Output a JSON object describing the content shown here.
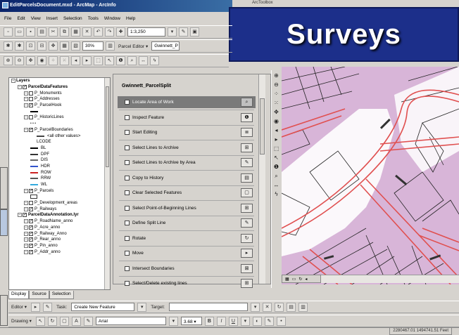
{
  "window": {
    "title": "EditParcelsDocument.mxd - ArcMap - ArcInfo",
    "menu": [
      "File",
      "Edit",
      "View",
      "Insert",
      "Selection",
      "Tools",
      "Window",
      "Help"
    ]
  },
  "toolbars": {
    "scale": "1:3,250",
    "zoom": "30%",
    "parcel_editor": "Parcel Editor ▾",
    "parcel_layer": "Gwinnett_P"
  },
  "toolbox_label": "ArcToolbox",
  "overlay_title": "Surveys",
  "toc": {
    "header": "Layers",
    "items": [
      {
        "label": "Layers",
        "indent": 0,
        "kind": "group"
      },
      {
        "label": "ParcelDataFeatures",
        "indent": 1,
        "kind": "group",
        "checked": true
      },
      {
        "label": "P_Monuments",
        "indent": 2,
        "kind": "layer",
        "checked": false
      },
      {
        "label": "P_Addresses",
        "indent": 2,
        "kind": "layer",
        "checked": false
      },
      {
        "label": "P_ParcelHook",
        "indent": 2,
        "kind": "layer",
        "checked": true
      },
      {
        "label": "",
        "indent": 3,
        "kind": "line",
        "color": "#000000"
      },
      {
        "label": "P_HistoricLines",
        "indent": 2,
        "kind": "layer",
        "checked": false
      },
      {
        "label": "",
        "indent": 3,
        "kind": "dots"
      },
      {
        "label": "P_ParcelBoundaries",
        "indent": 2,
        "kind": "layer",
        "checked": true
      },
      {
        "label": "<all other values>",
        "indent": 4,
        "kind": "line",
        "color": "#444444"
      },
      {
        "label": "LCODE",
        "indent": 4,
        "kind": "text"
      },
      {
        "label": "BL",
        "indent": 3,
        "kind": "line",
        "color": "#000000"
      },
      {
        "label": "DPF",
        "indent": 3,
        "kind": "line",
        "color": "#333333"
      },
      {
        "label": "DIS",
        "indent": 3,
        "kind": "line",
        "color": "#666666"
      },
      {
        "label": "HDR",
        "indent": 3,
        "kind": "line",
        "color": "#3355cc"
      },
      {
        "label": "ROW",
        "indent": 3,
        "kind": "line",
        "color": "#cc2222"
      },
      {
        "label": "RRW",
        "indent": 3,
        "kind": "line",
        "color": "#555555"
      },
      {
        "label": "WL",
        "indent": 3,
        "kind": "line",
        "color": "#33aadd"
      },
      {
        "label": "P_Parcels",
        "indent": 2,
        "kind": "layer",
        "checked": true
      },
      {
        "label": "",
        "indent": 3,
        "kind": "box"
      },
      {
        "label": "P_Development_areas",
        "indent": 2,
        "kind": "layer",
        "checked": false
      },
      {
        "label": "P_Railways",
        "indent": 2,
        "kind": "layer",
        "checked": true
      },
      {
        "label": "ParcelDataAnnotation.lyr",
        "indent": 1,
        "kind": "group",
        "checked": true
      },
      {
        "label": "P_RoadName_anno",
        "indent": 2,
        "kind": "layer",
        "checked": true
      },
      {
        "label": "P_Acre_anno",
        "indent": 2,
        "kind": "layer",
        "checked": true
      },
      {
        "label": "P_Railway_Anno",
        "indent": 2,
        "kind": "layer",
        "checked": true
      },
      {
        "label": "P_Rear_anno",
        "indent": 2,
        "kind": "layer",
        "checked": true
      },
      {
        "label": "P_Pin_anno",
        "indent": 2,
        "kind": "layer",
        "checked": true
      },
      {
        "label": "P_Addr_anno",
        "indent": 2,
        "kind": "layer",
        "checked": true
      }
    ],
    "tabs": [
      "Display",
      "Source",
      "Selection"
    ]
  },
  "parcel_panel": {
    "title": "Gwinnett_ParcelSplit",
    "rows": [
      {
        "label": "Locate Area of Work",
        "icon": "⌕",
        "selected": true
      },
      {
        "label": "Inspect Feature",
        "icon": "❶",
        "selected": false
      },
      {
        "label": "Start Editing",
        "icon": "≣",
        "selected": false
      },
      {
        "label": "Select Lines to Archive",
        "icon": "⊞",
        "selected": false
      },
      {
        "label": "Select Lines to Archive by Area",
        "icon": "✎",
        "selected": false
      },
      {
        "label": "Copy to History",
        "icon": "▤",
        "selected": false
      },
      {
        "label": "Clear Selected Features",
        "icon": "▢",
        "selected": false
      },
      {
        "label": "Select Point-of-Beginning Lines",
        "icon": "⊞",
        "selected": false
      },
      {
        "label": "Define Split Line",
        "icon": "✎",
        "selected": false
      },
      {
        "label": "Rotate",
        "icon": "↻",
        "selected": false
      },
      {
        "label": "Move",
        "icon": "▸",
        "selected": false
      },
      {
        "label": "Intersect Boundaries",
        "icon": "⊠",
        "selected": false
      },
      {
        "label": "Select/Delete existing lines",
        "icon": "⊞",
        "selected": false
      }
    ]
  },
  "editor_toolbar": {
    "editor": "Editor ▾",
    "task_label": "Task:",
    "task": "Create New Feature",
    "target_label": "Target:"
  },
  "drawing_toolbar": {
    "drawing": "Drawing ▾",
    "font": "Arial",
    "size": "3.68 ▾",
    "bold": "B",
    "italic": "I",
    "underline": "U",
    "text_tool": "A"
  },
  "status": {
    "coords": "2280467.01  1494741.51 Feet"
  },
  "colors": {
    "titlebar": "#0a246a",
    "overlay_bg": "#1c2f8a",
    "map_parcel": "#d8b5d8",
    "map_road": "#e05050"
  }
}
